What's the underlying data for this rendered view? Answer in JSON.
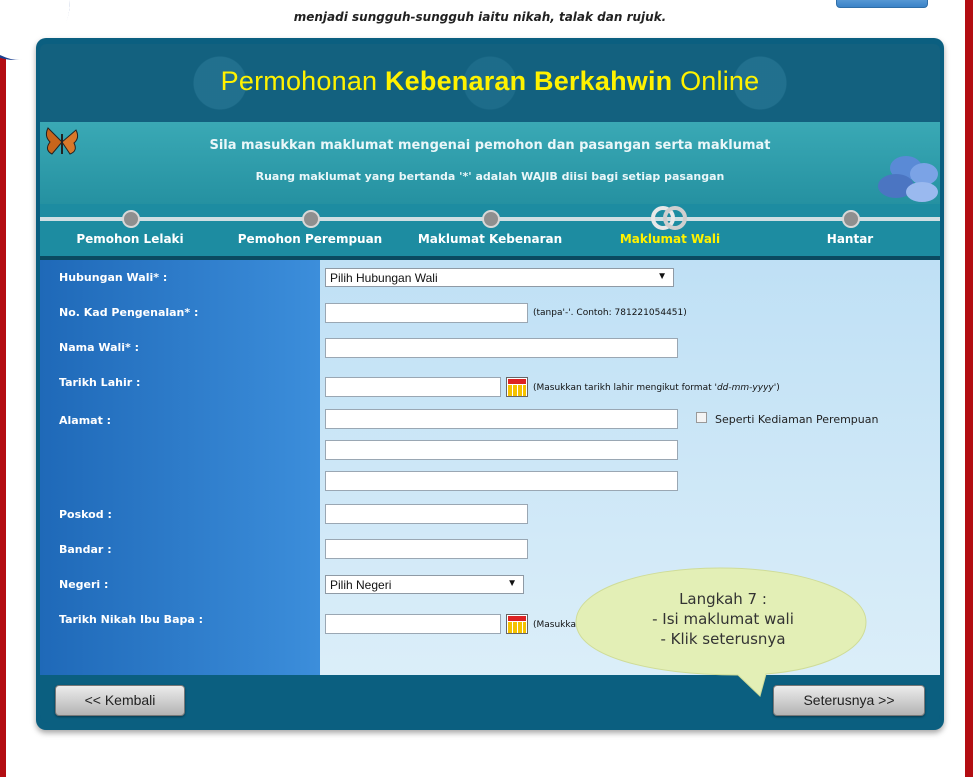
{
  "top": {
    "notice": "menjadi sungguh-sungguh iaitu nikah, talak dan rujuk."
  },
  "header": {
    "title_part1": "Permohonan ",
    "title_part2": "Kebenaran Berkahwin",
    "title_part3": " Online"
  },
  "intro": {
    "line1": "Sila masukkan maklumat mengenai pemohon dan pasangan serta maklumat",
    "line2": "Ruang maklumat yang bertanda '*' adalah WAJIB diisi bagi setiap pasangan"
  },
  "steps": [
    {
      "label": "Pemohon Lelaki"
    },
    {
      "label": "Pemohon Perempuan"
    },
    {
      "label": "Maklumat Kebenaran"
    },
    {
      "label": "Maklumat Wali",
      "active": true
    },
    {
      "label": "Hantar"
    }
  ],
  "form": {
    "hubungan_label": "Hubungan Wali* :",
    "hubungan_value": "Pilih Hubungan Wali",
    "ic_label": "No. Kad Pengenalan* :",
    "ic_hint": "(tanpa'-'. Contoh: 781221054451)",
    "nama_label": "Nama Wali* :",
    "tarikh_label": "Tarikh Lahir :",
    "tarikh_hint_pre": "(Masukkan tarikh lahir mengikut format ",
    "tarikh_hint_fmt": "'dd-mm-yyyy'",
    "tarikh_hint_post": ")",
    "alamat_label": "Alamat :",
    "seperti_label": "Seperti Kediaman Perempuan",
    "poskod_label": "Poskod :",
    "bandar_label": "Bandar :",
    "negeri_label": "Negeri :",
    "negeri_value": "Pilih Negeri",
    "nikah_label": "Tarikh Nikah Ibu Bapa :",
    "nikah_hint": "(Masukka"
  },
  "buttons": {
    "back": "<< Kembali",
    "next": "Seterusnya >>"
  },
  "callout": {
    "line1": "Langkah 7 :",
    "line2": "- Isi maklumat wali",
    "line3": "- Klik seterusnya"
  },
  "colors": {
    "panel": "#0b5f80",
    "title": "#fff200",
    "active_step": "#fff200",
    "form_left": "#2b7cc9",
    "form_right": "#cde8f7",
    "callout": "#e3efb6"
  }
}
